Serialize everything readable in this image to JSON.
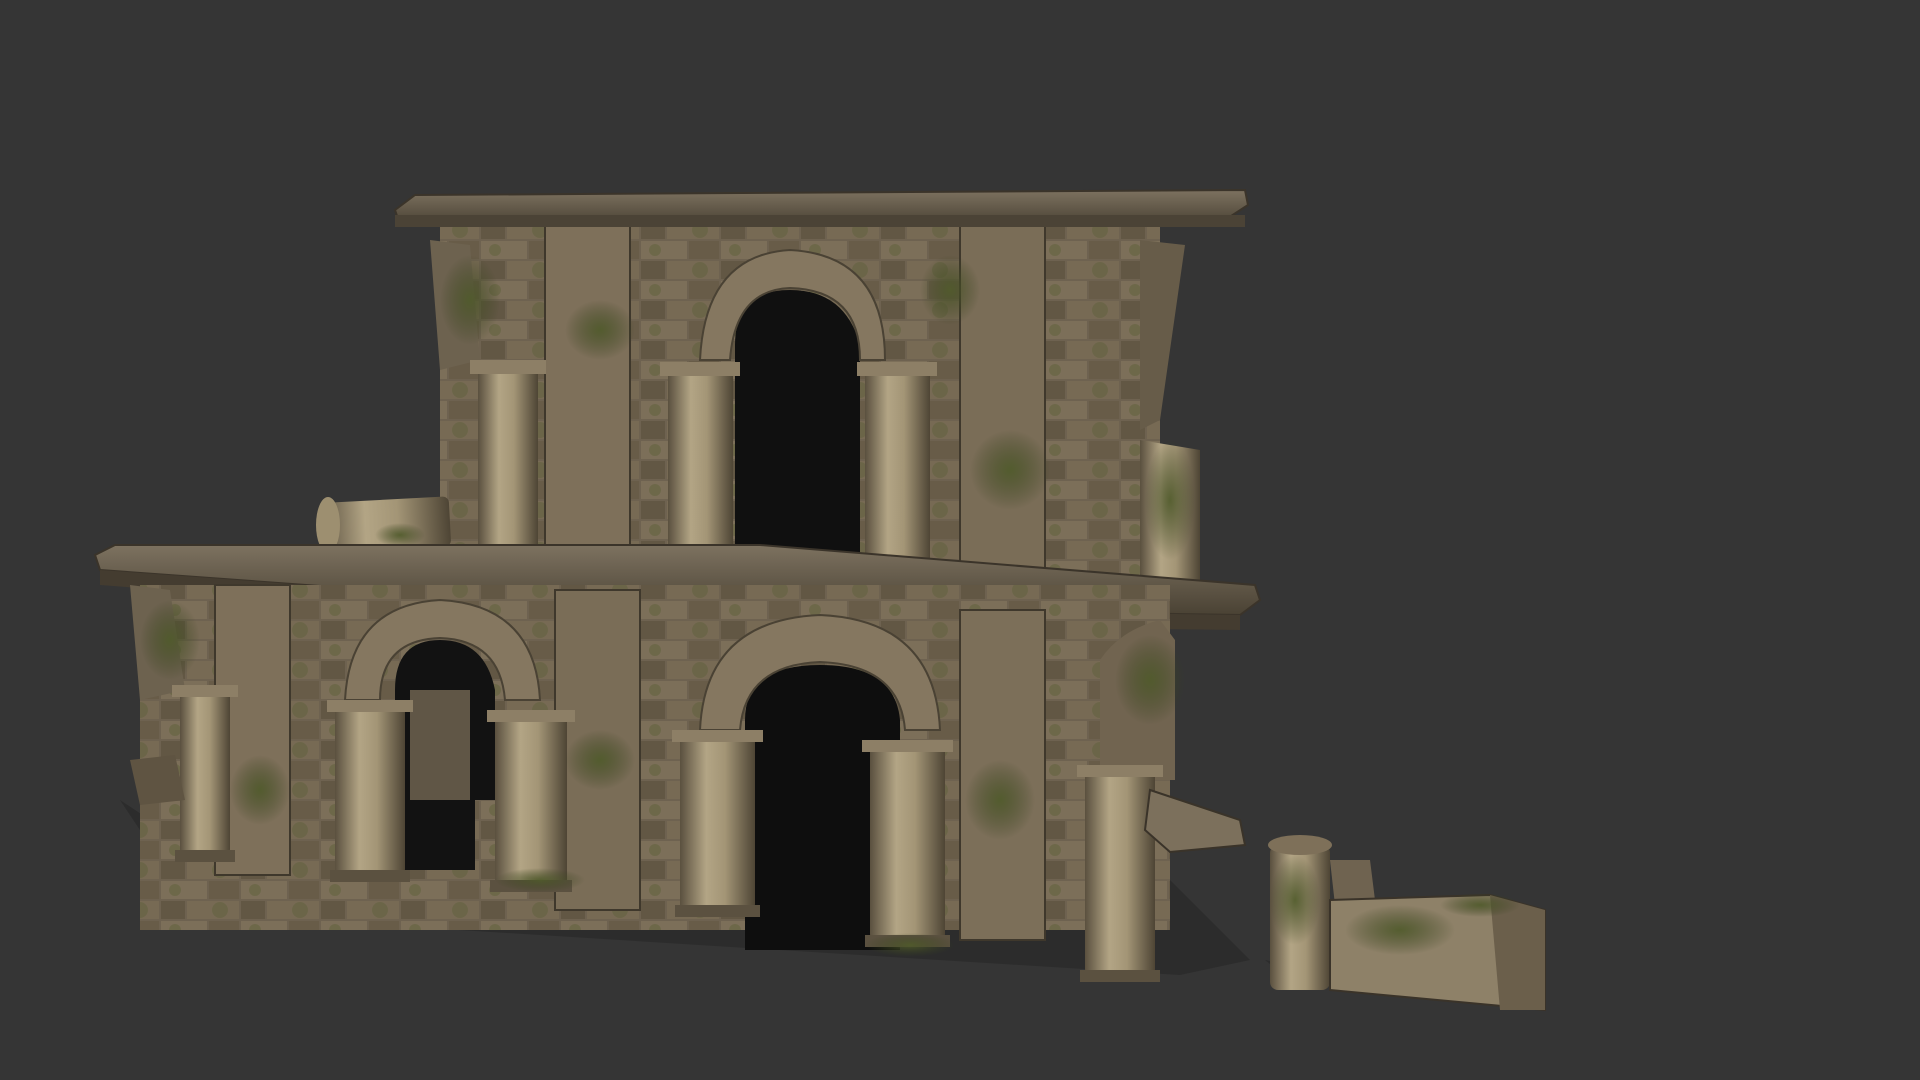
{
  "viewport": {
    "background_color": "#353535"
  },
  "model": {
    "subject": "ruined-stone-aqueduct",
    "colors": {
      "stone_light": "#a89a7c",
      "stone_mid": "#7a6c55",
      "stone_dark": "#4e4535",
      "stone_shadow": "#2f2a22",
      "moss": "#4f5a2a",
      "moss_dark": "#36401d",
      "arch_void": "#0e0e0e",
      "ground_shadow": "#2a2a2a"
    }
  }
}
